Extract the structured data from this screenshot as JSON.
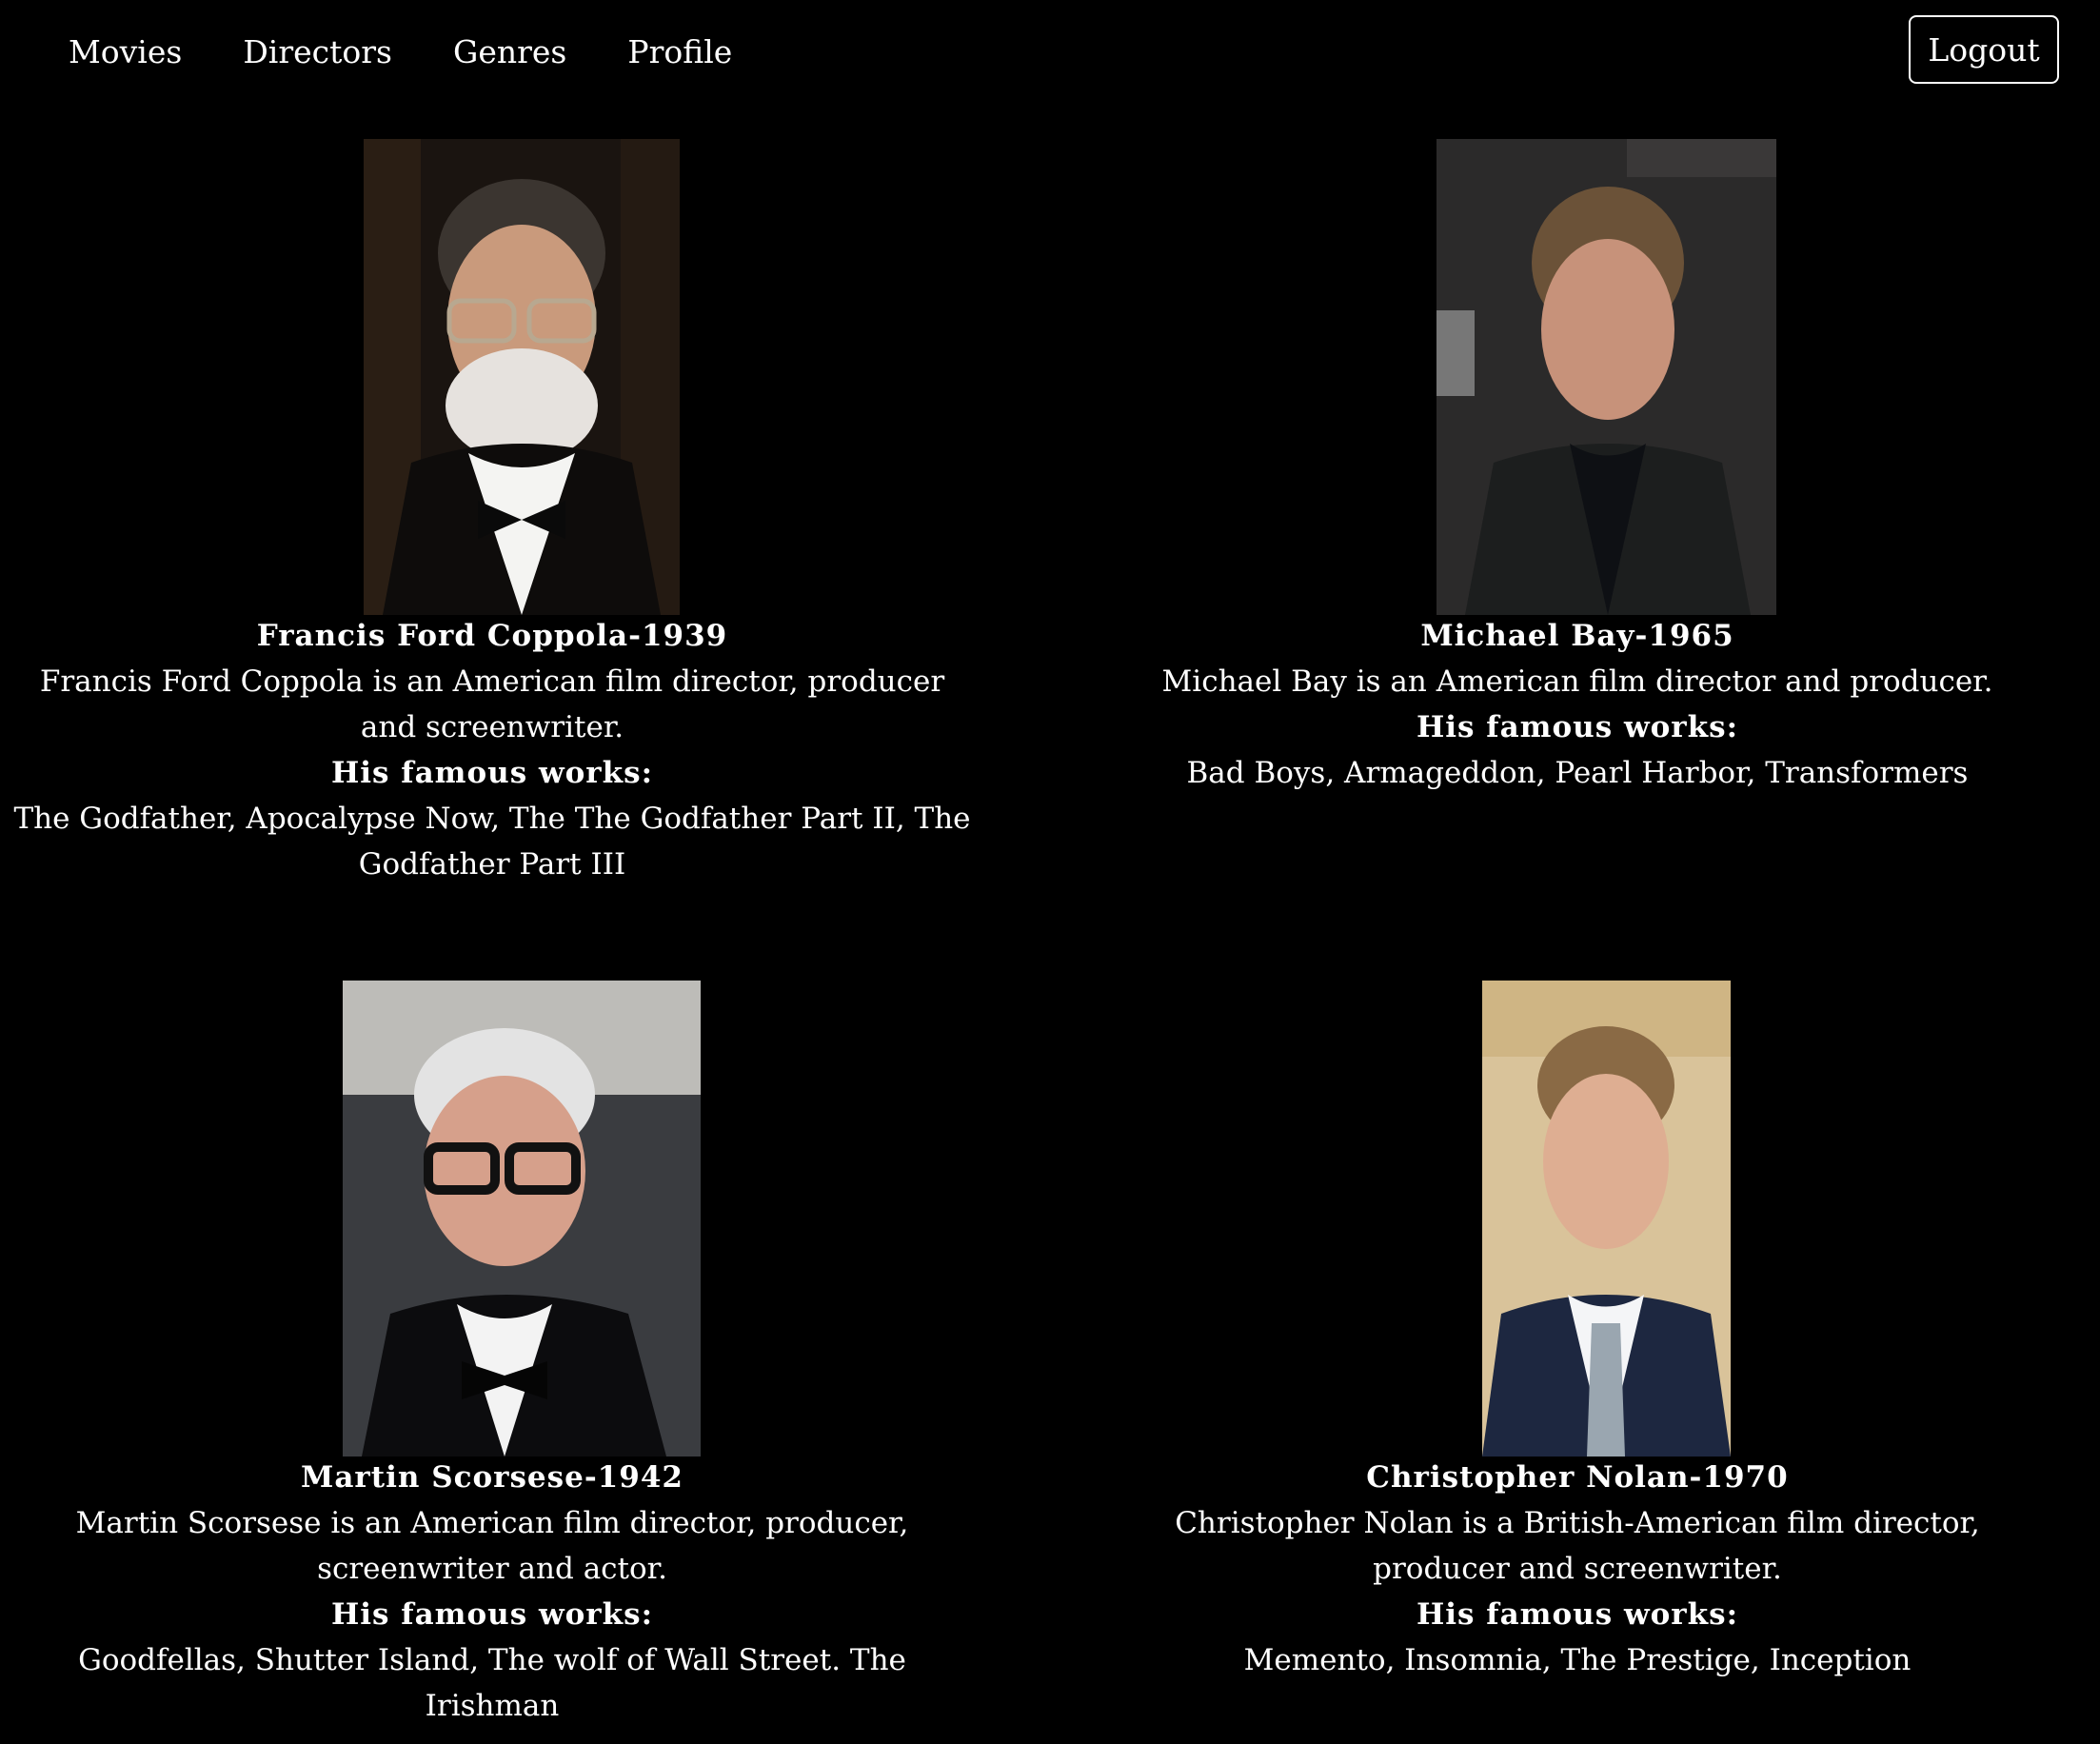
{
  "nav": {
    "links": [
      "Movies",
      "Directors",
      "Genres",
      "Profile"
    ],
    "logout_label": "Logout"
  },
  "directors": [
    {
      "name": "Francis Ford Coppola-1939",
      "description": "Francis Ford Coppola is an American film director, producer and screenwriter.",
      "works_heading": "His famous works:",
      "works": "The Godfather, Apocalypse Now, The The Godfather Part II, The Godfather Part III"
    },
    {
      "name": "Michael Bay-1965",
      "description": "Michael Bay is an American film director and producer.",
      "works_heading": "His famous works:",
      "works": "Bad Boys, Armageddon, Pearl Harbor, Transformers"
    },
    {
      "name": "Martin Scorsese-1942",
      "description": "Martin Scorsese is an American film director, producer, screenwriter and actor.",
      "works_heading": "His famous works:",
      "works": "Goodfellas, Shutter Island, The wolf of Wall Street. The Irishman"
    },
    {
      "name": "Christopher Nolan-1970",
      "description": "Christopher Nolan is a British-American film director, producer and screenwriter.",
      "works_heading": "His famous works:",
      "works": "Memento, Insomnia, The Prestige, Inception"
    }
  ],
  "colors": {
    "background": "#000000",
    "text": "#ffffff"
  }
}
